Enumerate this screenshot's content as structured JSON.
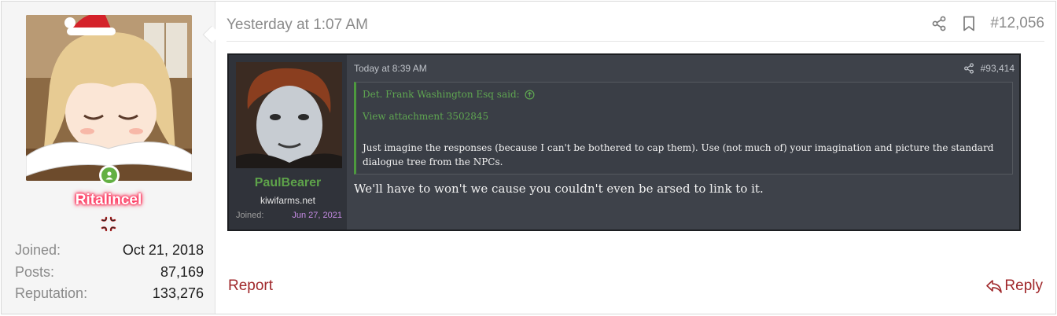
{
  "post": {
    "date": "Yesterday at 1:07 AM",
    "number": "#12,056",
    "icons": {
      "share": "share-icon",
      "bookmark": "bookmark-icon"
    }
  },
  "user": {
    "name": "Ritalincel",
    "avatar": "anime-girl-santa-hat-avatar",
    "online": true,
    "badge": "anger-vein-icon",
    "stats": [
      {
        "label": "Joined:",
        "value": "Oct 21, 2018"
      },
      {
        "label": "Posts:",
        "value": "87,169"
      },
      {
        "label": "Reputation:",
        "value": "133,276"
      }
    ]
  },
  "embed": {
    "user": {
      "name": "PaulBearer",
      "site": "kiwifarms.net",
      "joined_label": "Joined:",
      "joined_value": "Jun 27, 2021",
      "avatar": "pale-face-man-avatar"
    },
    "date": "Today at 8:39 AM",
    "number": "#93,414",
    "quote": {
      "author": "Det. Frank Washington Esq said:",
      "attachment": "View attachment 3502845",
      "body": "Just imagine the responses (because I can't be bothered to cap them). Use (not much of) your imagination and picture the standard dialogue tree from the NPCs."
    },
    "message": "We'll have to won't we cause you couldn't even be arsed to link to it."
  },
  "footer": {
    "report_label": "Report",
    "reply_label": "Reply"
  },
  "colors": {
    "link_red": "#a0282b",
    "username_glow": "#ff2b55",
    "embed_bg": "#3e424a",
    "embed_green": "#5ea34a",
    "online_green": "#63b043"
  }
}
